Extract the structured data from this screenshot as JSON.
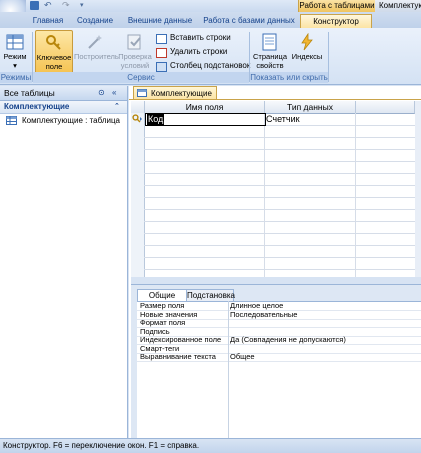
{
  "window": {
    "context_group": "Работа с таблицами",
    "context_group2": "Комплектую"
  },
  "ribbon_tabs": [
    "Главная",
    "Создание",
    "Внешние данные",
    "Работа с базами данных",
    "Конструктор"
  ],
  "active_tab_index": 4,
  "ribbon": {
    "groups": {
      "views": {
        "label": "Режимы",
        "view_button": "Режим"
      },
      "service": {
        "label": "Сервис",
        "key_field": [
          "Ключевое",
          "поле"
        ],
        "builder": "Построитель",
        "test_rules": [
          "Проверка",
          "условий"
        ],
        "insert_rows": "Вставить строки",
        "delete_rows": "Удалить строки",
        "lookup_column": "Столбец подстановок"
      },
      "show_hide": {
        "label": "Показать или скрыть",
        "property_sheet": [
          "Страница",
          "свойств"
        ],
        "indexes": "Индексы"
      }
    }
  },
  "nav": {
    "header": "Все таблицы",
    "group": "Комплектующие",
    "items": [
      {
        "label": "Комплектующие : таблица",
        "icon": "table-icon"
      }
    ]
  },
  "document": {
    "tab_label": "Комплектующие",
    "columns": [
      "Имя поля",
      "Тип данных"
    ],
    "rows": [
      {
        "field_name": "Код",
        "data_type": "Счетчик",
        "primary_key": true
      }
    ]
  },
  "properties": {
    "tabs": [
      "Общие",
      "Подстановка"
    ],
    "active_tab": 0,
    "rows": [
      {
        "name": "Размер поля",
        "value": "Длинное целое"
      },
      {
        "name": "Новые значения",
        "value": "Последовательные"
      },
      {
        "name": "Формат поля",
        "value": ""
      },
      {
        "name": "Подпись",
        "value": ""
      },
      {
        "name": "Индексированное поле",
        "value": "Да (Совпадения не допускаются)"
      },
      {
        "name": "Смарт-теги",
        "value": ""
      },
      {
        "name": "Выравнивание текста",
        "value": "Общее"
      }
    ]
  },
  "status_bar": "Конструктор.  F6 = переключение окон.  F1 = справка.",
  "colors": {
    "accent": "#f5c352",
    "ribbon_text": "#15428b"
  }
}
